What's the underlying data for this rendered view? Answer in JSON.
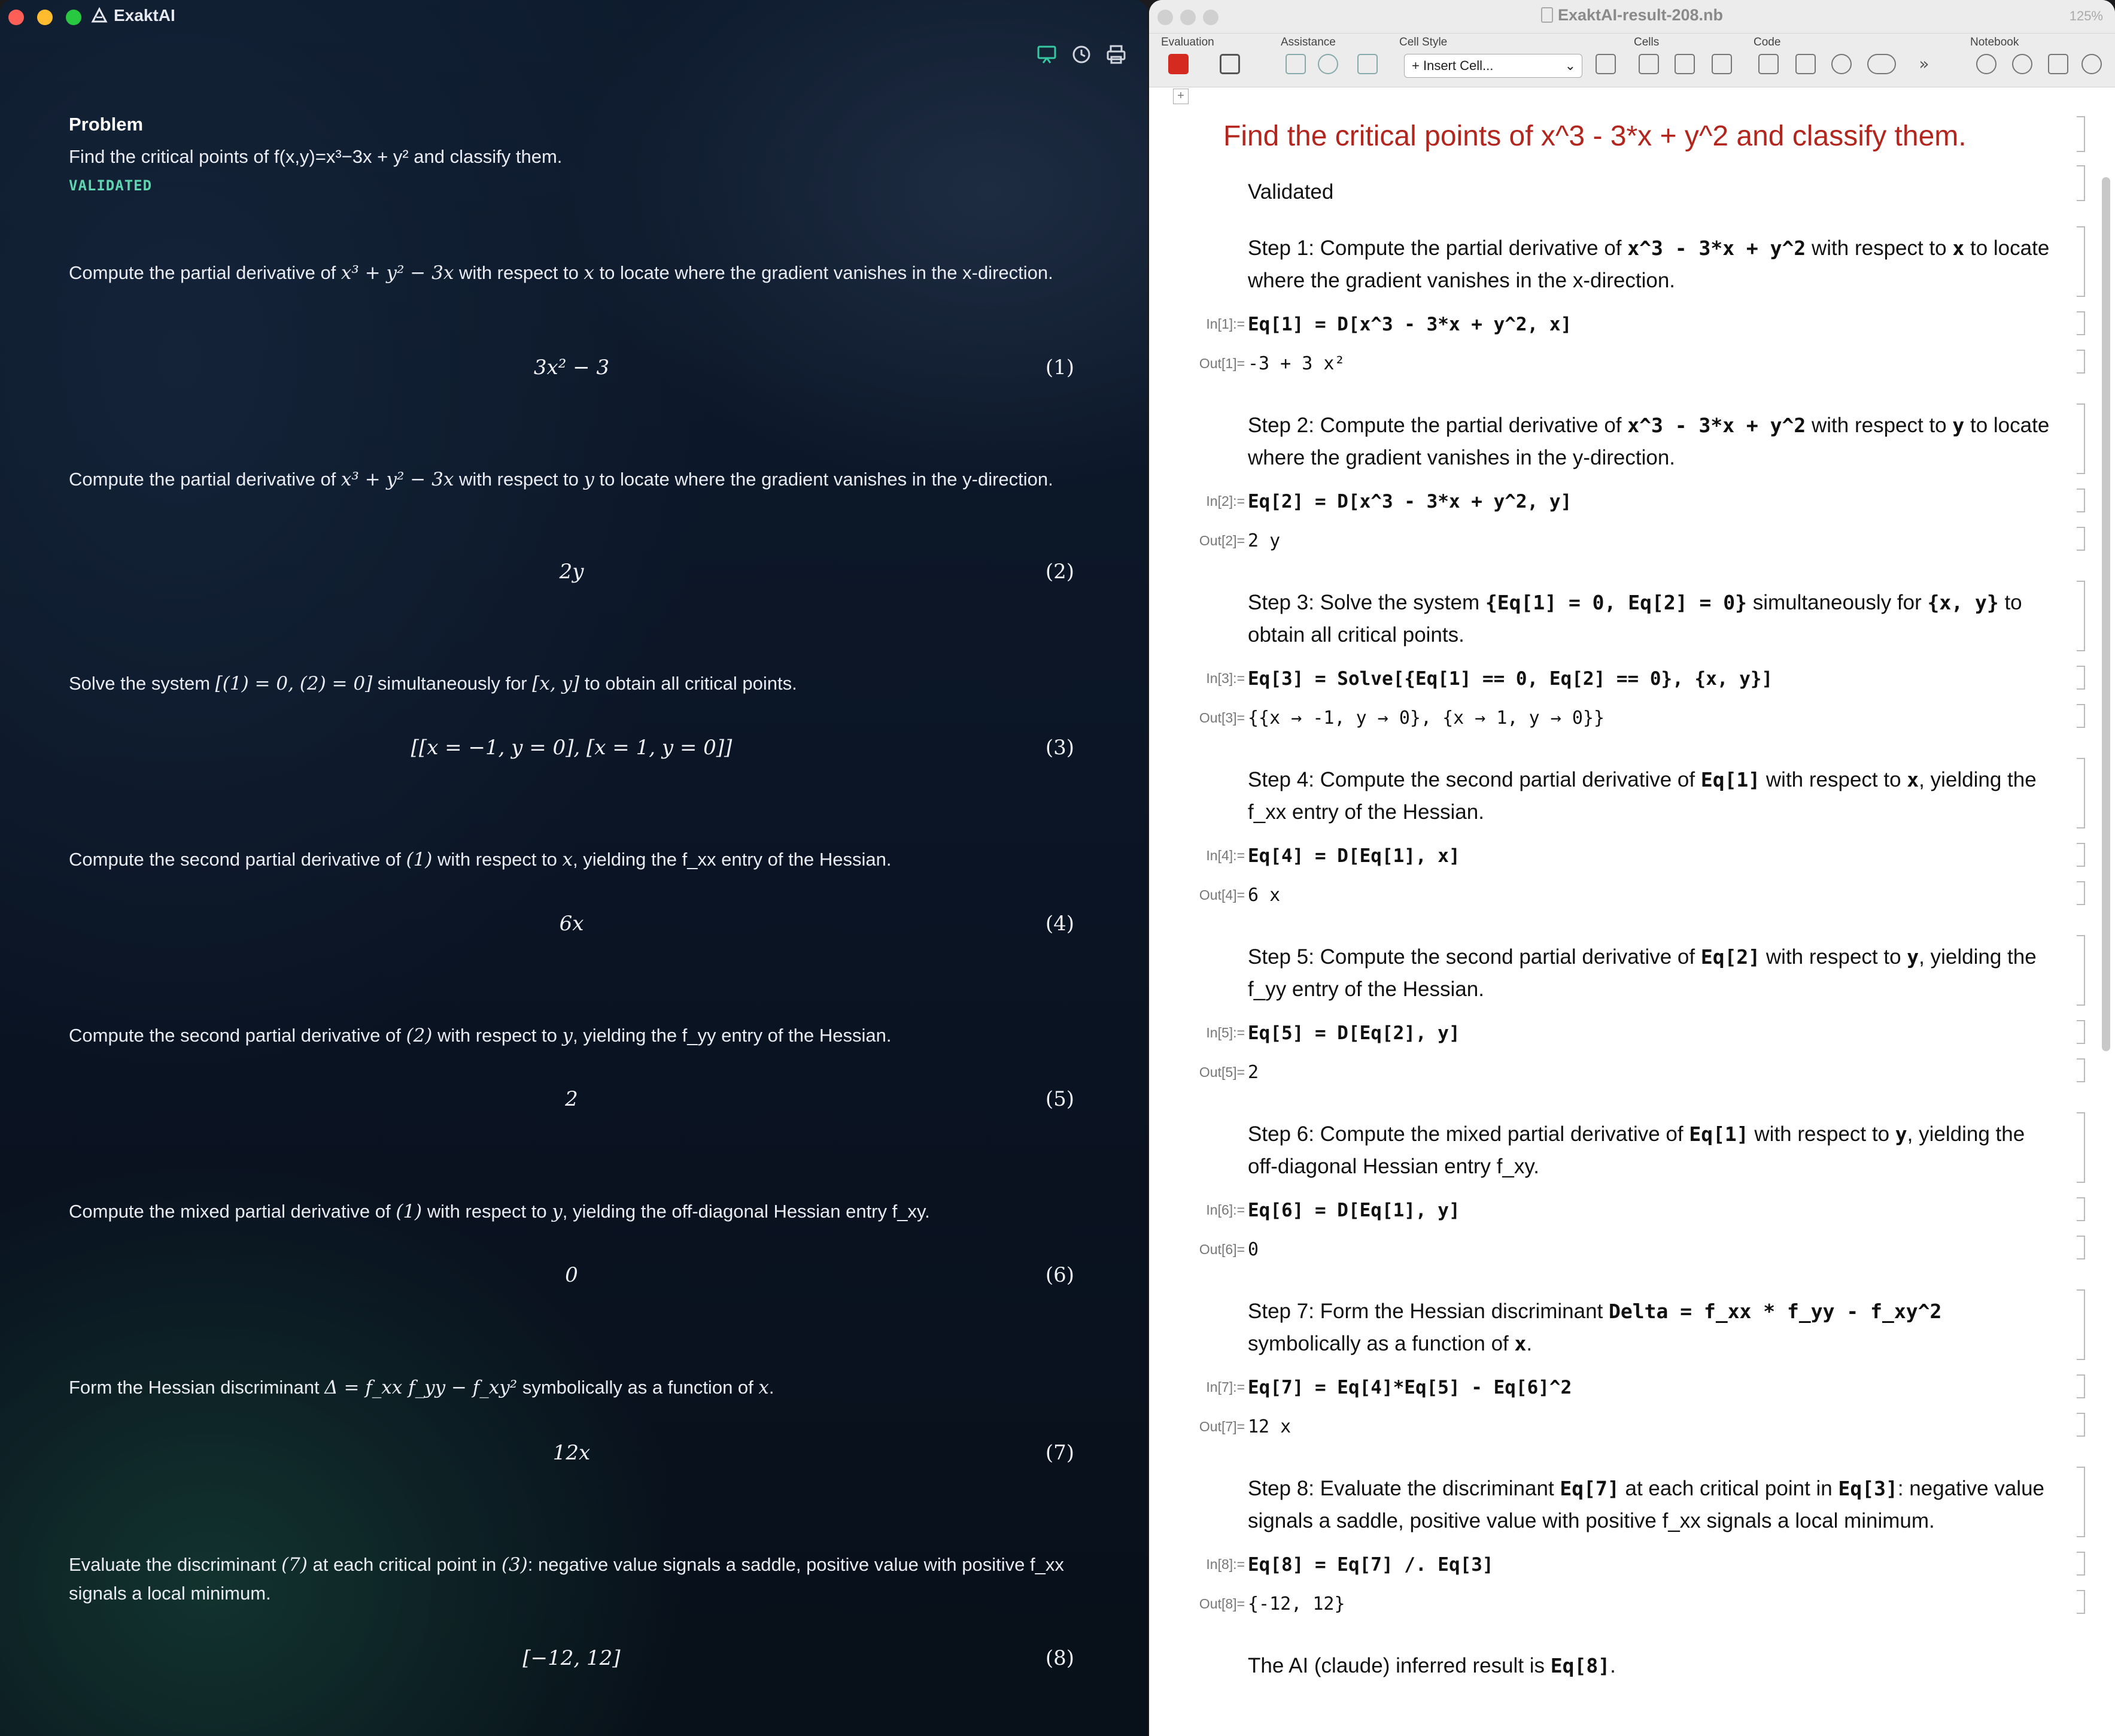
{
  "left_app": {
    "title": "ExaktAI",
    "problem_heading": "Problem",
    "problem_text": "Find the critical points of f(x,y)=x³−3x + y² and classify them.",
    "status": "VALIDATED",
    "steps": [
      {
        "pre": "Compute the partial derivative of ",
        "math": "x³ + y² − 3x",
        "post": " with respect to ",
        "var": "x",
        "tail": " to locate where the gradient vanishes in the x-direction.",
        "result": "3x² − 3",
        "num": "(1)"
      },
      {
        "pre": "Compute the partial derivative of ",
        "math": "x³ + y² − 3x",
        "post": " with respect to ",
        "var": "y",
        "tail": " to locate where the gradient vanishes in the y-direction.",
        "result": "2y",
        "num": "(2)"
      },
      {
        "pre": "Solve the system ",
        "math": "[(1) = 0, (2) = 0]",
        "post": " simultaneously for ",
        "var": "[x, y]",
        "tail": " to obtain all critical points.",
        "result": "[[x = −1, y = 0], [x = 1, y = 0]]",
        "num": "(3)"
      },
      {
        "pre": "Compute the second partial derivative of ",
        "math": "(1)",
        "post": " with respect to ",
        "var": "x",
        "tail": ", yielding the f_xx entry of the Hessian.",
        "result": "6x",
        "num": "(4)"
      },
      {
        "pre": "Compute the second partial derivative of ",
        "math": "(2)",
        "post": " with respect to ",
        "var": "y",
        "tail": ", yielding the f_yy entry of the Hessian.",
        "result": "2",
        "num": "(5)"
      },
      {
        "pre": "Compute the mixed partial derivative of ",
        "math": "(1)",
        "post": " with respect to ",
        "var": "y",
        "tail": ", yielding the off-diagonal Hessian entry f_xy.",
        "result": "0",
        "num": "(6)"
      },
      {
        "pre": "Form the Hessian discriminant ",
        "math": "Δ = f_xx f_yy − f_xy²",
        "post": " symbolically as a function of ",
        "var": "x",
        "tail": ".",
        "result": "12x",
        "num": "(7)"
      },
      {
        "pre": "Evaluate the discriminant ",
        "math": "(7)",
        "post": " at each critical point in ",
        "var": "(3)",
        "tail": ": negative value signals a saddle, positive value with positive f_xx signals a local minimum.",
        "result": "[−12, 12]",
        "num": "(8)"
      }
    ]
  },
  "right_app": {
    "window_title": "ExaktAI-result-208.nb",
    "zoom": "125%",
    "toolbar_groups": [
      "Evaluation",
      "Assistance",
      "Cell Style",
      "Cells",
      "Code",
      "Notebook"
    ],
    "cell_style_value": "Insert Cell...",
    "title": "Find the critical points of x^3 - 3*x + y^2 and classify them.",
    "validated": "Validated",
    "cells": [
      {
        "text_a": "Step 1: Compute the partial derivative of ",
        "code_a": "x^3 - 3*x + y^2",
        "text_b": " with respect to ",
        "code_b": "x",
        "text_c": " to locate where the gradient vanishes in the x-direction.",
        "in_label": "In[1]:=",
        "input": "Eq[1] = D[x^3 - 3*x + y^2, x]",
        "out_label": "Out[1]=",
        "output": "-3 + 3 x²"
      },
      {
        "text_a": "Step 2: Compute the partial derivative of ",
        "code_a": "x^3 - 3*x + y^2",
        "text_b": " with respect to ",
        "code_b": "y",
        "text_c": " to locate where the gradient vanishes in the y-direction.",
        "in_label": "In[2]:=",
        "input": "Eq[2] = D[x^3 - 3*x + y^2, y]",
        "out_label": "Out[2]=",
        "output": "2 y"
      },
      {
        "text_a": "Step 3: Solve the system ",
        "code_a": "{Eq[1] = 0, Eq[2] = 0}",
        "text_b": " simultaneously for ",
        "code_b": "{x, y}",
        "text_c": " to obtain all critical points.",
        "in_label": "In[3]:=",
        "input": "Eq[3] = Solve[{Eq[1] == 0, Eq[2] == 0}, {x, y}]",
        "out_label": "Out[3]=",
        "output": "{{x → -1, y → 0}, {x → 1, y → 0}}"
      },
      {
        "text_a": "Step 4: Compute the second partial derivative of ",
        "code_a": "Eq[1]",
        "text_b": " with respect to ",
        "code_b": "x",
        "text_c": ", yielding the f_xx entry of the Hessian.",
        "in_label": "In[4]:=",
        "input": "Eq[4] = D[Eq[1], x]",
        "out_label": "Out[4]=",
        "output": "6 x"
      },
      {
        "text_a": "Step 5: Compute the second partial derivative of ",
        "code_a": "Eq[2]",
        "text_b": " with respect to ",
        "code_b": "y",
        "text_c": ", yielding the f_yy entry of the Hessian.",
        "in_label": "In[5]:=",
        "input": "Eq[5] = D[Eq[2], y]",
        "out_label": "Out[5]=",
        "output": "2"
      },
      {
        "text_a": "Step 6: Compute the mixed partial derivative of ",
        "code_a": "Eq[1]",
        "text_b": " with respect to ",
        "code_b": "y",
        "text_c": ", yielding the off-diagonal Hessian entry f_xy.",
        "in_label": "In[6]:=",
        "input": "Eq[6] = D[Eq[1], y]",
        "out_label": "Out[6]=",
        "output": "0"
      },
      {
        "text_a": "Step 7: Form the Hessian discriminant ",
        "code_a": "Delta = f_xx * f_yy - f_xy^2",
        "text_b": " symbolically as a function of ",
        "code_b": "x",
        "text_c": ".",
        "in_label": "In[7]:=",
        "input": "Eq[7] = Eq[4]*Eq[5] - Eq[6]^2",
        "out_label": "Out[7]=",
        "output": "12 x"
      },
      {
        "text_a": "Step 8: Evaluate the discriminant ",
        "code_a": "Eq[7]",
        "text_b": " at each critical point in ",
        "code_b": "Eq[3]",
        "text_c": ": negative value signals a saddle, positive value with positive f_xx signals a local minimum.",
        "in_label": "In[8]:=",
        "input": "Eq[8] = Eq[7] /. Eq[3]",
        "out_label": "Out[8]=",
        "output": "{-12, 12}"
      }
    ],
    "conclusion_a": "The AI (claude) inferred result is ",
    "conclusion_code": "Eq[8]",
    "conclusion_b": "."
  },
  "colors": {
    "accent_green": "#5fd6b0",
    "title_red": "#b3261e",
    "close": "#ff5f57",
    "minimize": "#febc2e",
    "zoom": "#28c840"
  }
}
